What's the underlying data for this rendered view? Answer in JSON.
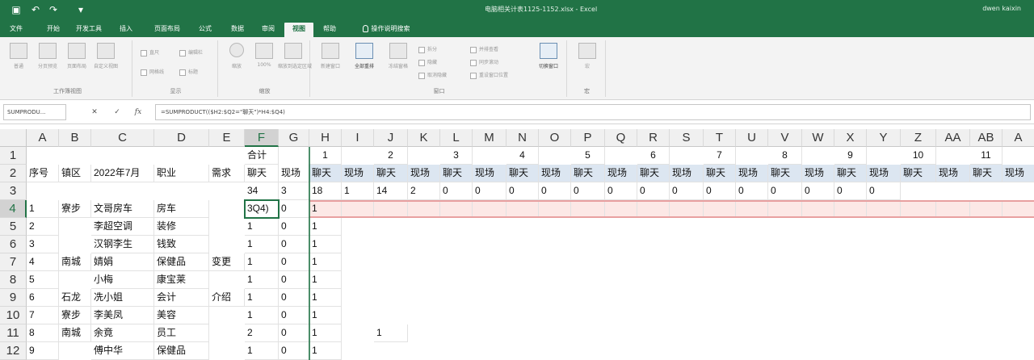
{
  "titlebar": {
    "doc_title": "电脑相关计表1125-1152.xlsx  -  Excel",
    "user": "dwen kaixin",
    "quick_access": [
      "save-icon",
      "undo-icon",
      "redo-icon",
      "more-icon"
    ]
  },
  "tabs": [
    "文件",
    "开始",
    "开发工具",
    "插入",
    "页面布局",
    "公式",
    "数据",
    "审阅",
    "视图",
    "帮助",
    "操作说明搜索"
  ],
  "active_tab": "视图",
  "ribbon": {
    "groups": [
      {
        "label": "工作簿视图",
        "buttons": [
          "普通",
          "分页预览",
          "页面布局",
          "自定义视图"
        ]
      },
      {
        "label": "显示",
        "items": [
          "直尺",
          "编辑栏",
          "网格线",
          "标题"
        ]
      },
      {
        "label": "缩放",
        "buttons": [
          "缩放",
          "100%",
          "缩放到选定区域"
        ]
      },
      {
        "label": "窗口",
        "buttons": [
          "新建窗口",
          "全部重排",
          "冻结窗格"
        ],
        "items": [
          "拆分",
          "隐藏",
          "取消隐藏",
          "并排查看",
          "同步滚动",
          "重设窗口位置"
        ],
        "extra": "切换窗口"
      },
      {
        "label": "宏",
        "buttons": [
          "宏"
        ]
      }
    ]
  },
  "formula_bar": {
    "name_box": "SUMPRODU...",
    "cancel": "✕",
    "enter": "✓",
    "fx": "fx",
    "formula": "=SUMPRODUCT(($H2:$Q2=\"聊天\")*H4:$Q4)"
  },
  "columns": [
    "A",
    "B",
    "C",
    "D",
    "E",
    "F",
    "G",
    "H",
    "I",
    "J",
    "K",
    "L",
    "M",
    "N",
    "O",
    "P",
    "Q",
    "R",
    "S",
    "T",
    "U",
    "V",
    "W",
    "X",
    "Y",
    "Z",
    "AA",
    "AB",
    "A"
  ],
  "rows": [
    "1",
    "2",
    "3",
    "4",
    "5",
    "6",
    "7",
    "8",
    "9",
    "10",
    "11",
    "12"
  ],
  "sheet": {
    "row1": {
      "F": "合计",
      "H": "1",
      "J": "2",
      "L": "3",
      "N": "4",
      "P": "5",
      "R": "6",
      "T": "7",
      "V": "8",
      "X": "9",
      "Z": "10",
      "AB": "11"
    },
    "row2": {
      "A": "序号",
      "B": "镇区",
      "C": "2022年7月",
      "D": "职业",
      "E": "需求",
      "F": "聊天",
      "G": "现场",
      "pairs": [
        "聊天",
        "现场",
        "聊天",
        "现场",
        "聊天",
        "现场",
        "聊天",
        "现场",
        "聊天",
        "现场",
        "聊天",
        "现场",
        "聊天",
        "现场",
        "聊天",
        "现场",
        "聊天",
        "现场",
        "聊天",
        "现场",
        "聊天",
        "现场"
      ]
    },
    "row3": {
      "F": "34",
      "G": "3",
      "values": [
        "18",
        "1",
        "14",
        "2",
        "0",
        "0",
        "0",
        "0",
        "0",
        "0",
        "0",
        "0",
        "0",
        "0",
        "0",
        "0",
        "0",
        "0"
      ]
    },
    "data_rows": [
      {
        "A": "1",
        "B": "寮步",
        "C": "文哥房车",
        "D": "房车",
        "E": "",
        "F": "3Q4)",
        "G": "0",
        "H": "1",
        "J": ""
      },
      {
        "A": "2",
        "B": "",
        "C": "李超空调",
        "D": "装修",
        "E": "",
        "F": "1",
        "G": "0",
        "H": "1",
        "J": ""
      },
      {
        "A": "3",
        "B": "",
        "C": "汉钢李生",
        "D": "钱致",
        "E": "",
        "F": "1",
        "G": "0",
        "H": "1",
        "J": ""
      },
      {
        "A": "4",
        "B": "南城",
        "C": "婧娟",
        "D": "保健品",
        "E": "变更",
        "F": "1",
        "G": "0",
        "H": "1",
        "J": ""
      },
      {
        "A": "5",
        "B": "",
        "C": "小梅",
        "D": "康宝莱",
        "E": "",
        "F": "1",
        "G": "0",
        "H": "1",
        "J": ""
      },
      {
        "A": "6",
        "B": "石龙",
        "C": "冼小姐",
        "D": "会计",
        "E": "介绍",
        "F": "1",
        "G": "0",
        "H": "1",
        "J": ""
      },
      {
        "A": "7",
        "B": "寮步",
        "C": "李美凤",
        "D": "美容",
        "E": "",
        "F": "1",
        "G": "0",
        "H": "1",
        "J": ""
      },
      {
        "A": "8",
        "B": "南城",
        "C": "余竟",
        "D": "员工",
        "E": "",
        "F": "2",
        "G": "0",
        "H": "1",
        "J": "1"
      },
      {
        "A": "9",
        "B": "",
        "C": "傅中华",
        "D": "保健品",
        "E": "",
        "F": "1",
        "G": "0",
        "H": "1",
        "J": ""
      }
    ]
  },
  "colors": {
    "excel_green": "#217346",
    "header_band": "#dce6f1",
    "selected_row": "#fce8e6"
  }
}
